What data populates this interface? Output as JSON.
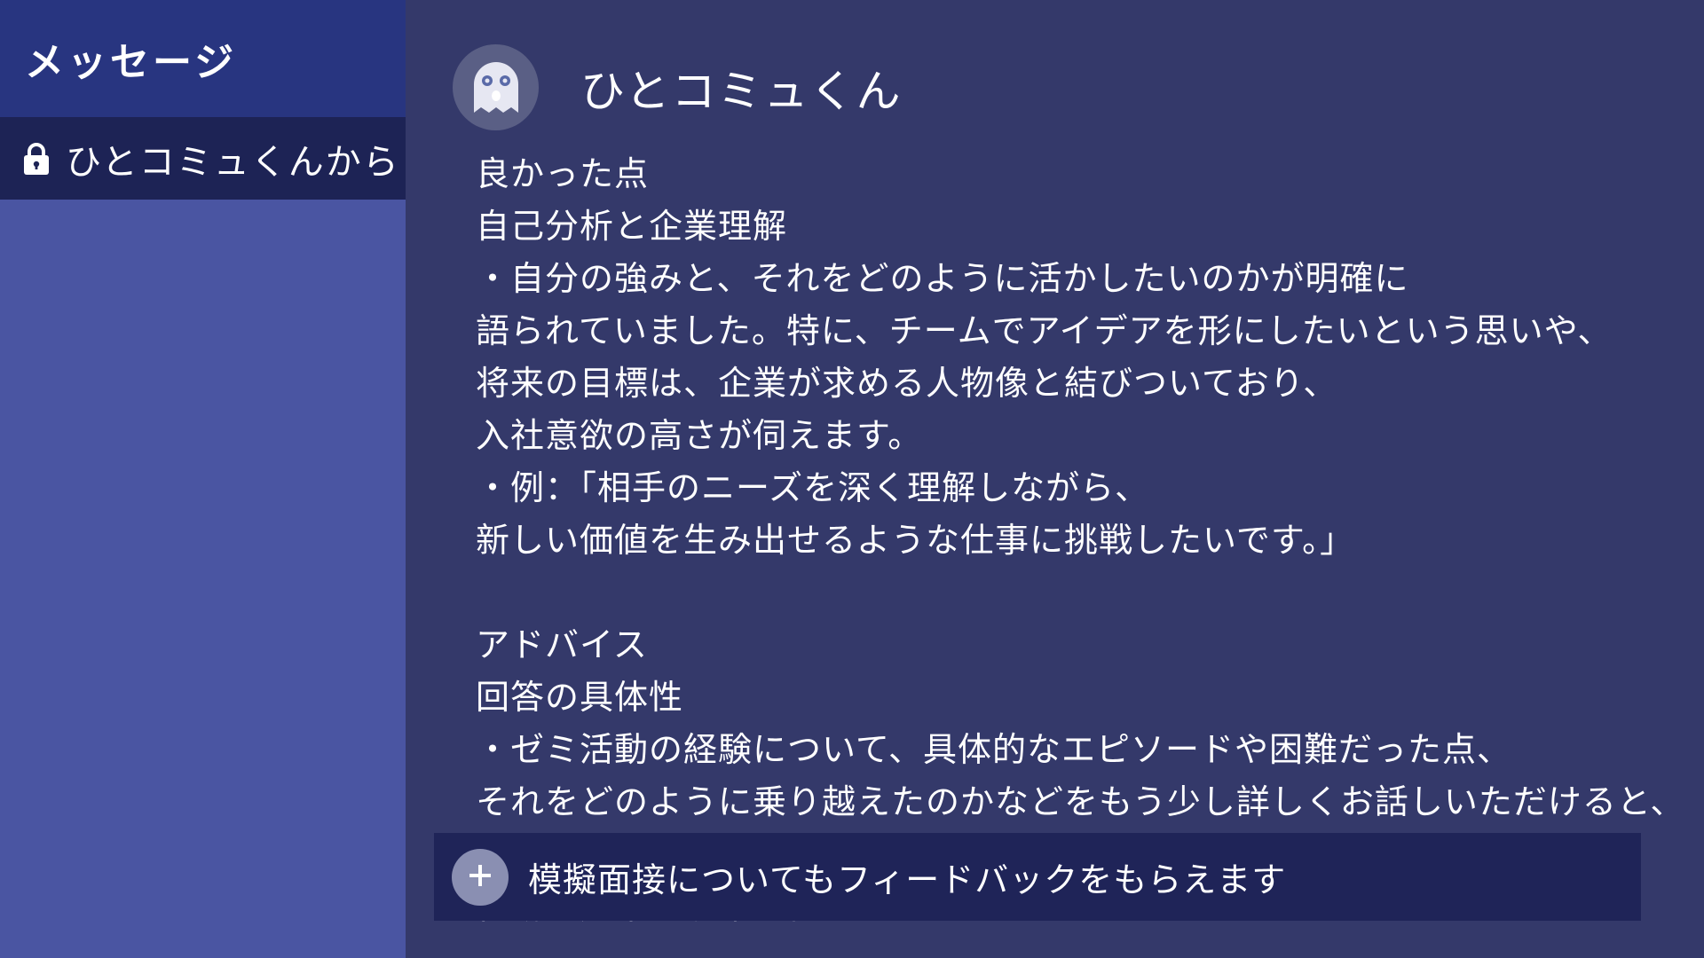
{
  "sidebar": {
    "title": "メッセージ",
    "items": [
      {
        "label": "ひとコミュくんから",
        "icon": "lock-icon"
      }
    ]
  },
  "chat": {
    "name": "ひとコミュくん",
    "avatar_icon": "ghost-icon",
    "lines": [
      "良かった点",
      "自己分析と企業理解",
      "・自分の強みと、それをどのように活かしたいのかが明確に",
      "語られていました。特に、チームでアイデアを形にしたいという思いや、",
      "将来の目標は、企業が求める人物像と結びついており、",
      "入社意欲の高さが伺えます。",
      "・例：「相手のニーズを深く理解しながら、",
      "新しい価値を生み出せるような仕事に挑戦したいです。」",
      "",
      "アドバイス",
      "回答の具体性",
      "・ゼミ活動の経験について、具体的なエピソードや困難だった点、",
      "それをどのように乗り越えたのかなどをもう少し詳しくお話しいただけると、",
      "",
      "行動や成果を明確に伝えられるように意識してみてください"
    ]
  },
  "composer": {
    "text": "模擬面接についてもフィードバックをもらえます",
    "button_icon": "plus-icon"
  },
  "colors": {
    "sidebar_bg": "#4a55a2",
    "sidebar_header_bg": "#283580",
    "sidebar_item_bg": "#1d2355",
    "main_bg": "#34396a",
    "composer_bg": "#1f2458"
  }
}
